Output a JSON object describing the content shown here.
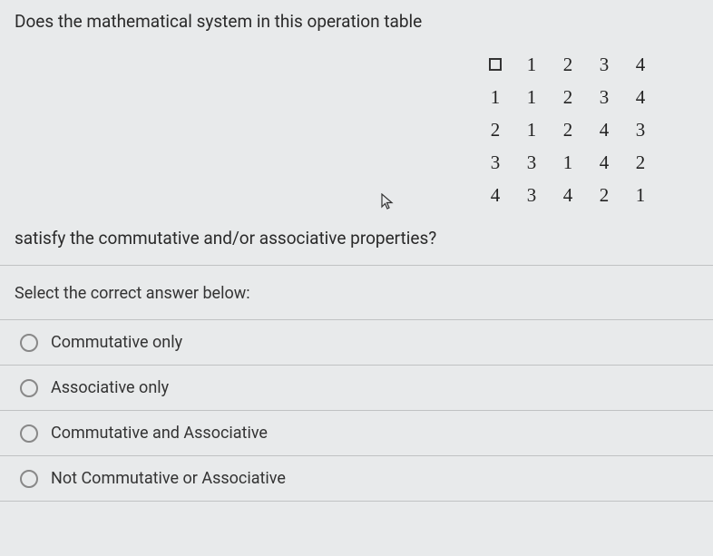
{
  "question": {
    "prefix": "Does the mathematical system in this operation table",
    "suffix": "satisfy the commutative and/or associative properties?"
  },
  "table": {
    "header": [
      "1",
      "2",
      "3",
      "4"
    ],
    "rows": [
      {
        "label": "1",
        "cells": [
          "1",
          "2",
          "3",
          "4"
        ]
      },
      {
        "label": "2",
        "cells": [
          "1",
          "2",
          "4",
          "3"
        ]
      },
      {
        "label": "3",
        "cells": [
          "3",
          "1",
          "4",
          "2"
        ]
      },
      {
        "label": "4",
        "cells": [
          "3",
          "4",
          "2",
          "1"
        ]
      }
    ]
  },
  "prompt": "Select the correct answer below:",
  "options": [
    "Commutative only",
    "Associative only",
    "Commutative and Associative",
    "Not Commutative or Associative"
  ]
}
